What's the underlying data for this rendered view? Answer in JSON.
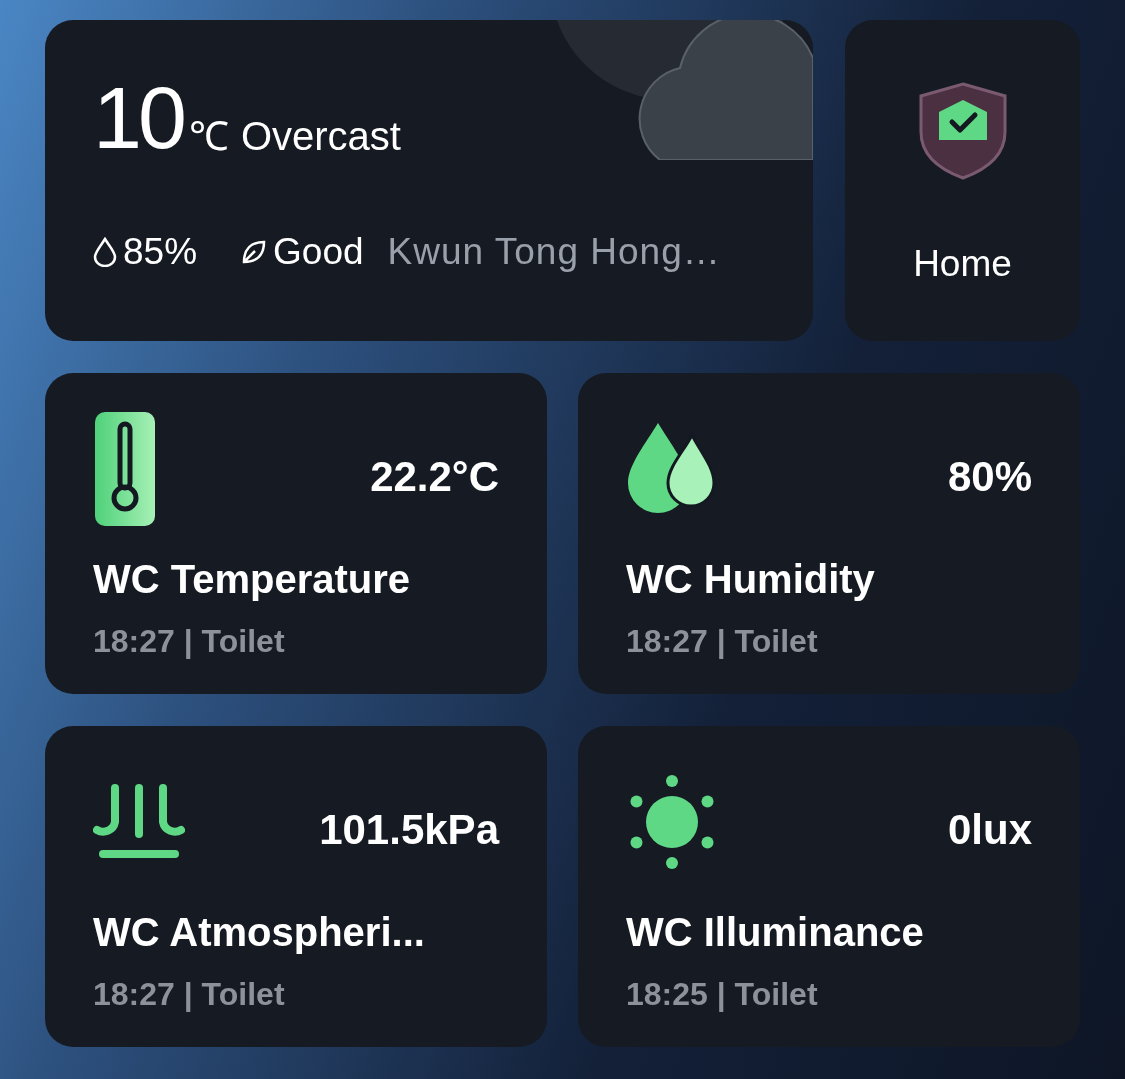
{
  "weather": {
    "temperature": "10",
    "unit": "℃",
    "condition": "Overcast",
    "humidity": "85%",
    "air_quality": "Good",
    "location": "Kwun Tong Hong…"
  },
  "home": {
    "label": "Home"
  },
  "sensors": [
    {
      "kind": "temperature",
      "value": "22.2°C",
      "name": "WC Temperature",
      "meta": "18:27 | Toilet"
    },
    {
      "kind": "humidity",
      "value": "80%",
      "name": "WC Humidity",
      "meta": "18:27 | Toilet"
    },
    {
      "kind": "pressure",
      "value": "101.5kPa",
      "name": "WC Atmospheri...",
      "meta": "18:27 | Toilet"
    },
    {
      "kind": "illuminance",
      "value": "0lux",
      "name": "WC Illuminance",
      "meta": "18:25 | Toilet"
    }
  ]
}
